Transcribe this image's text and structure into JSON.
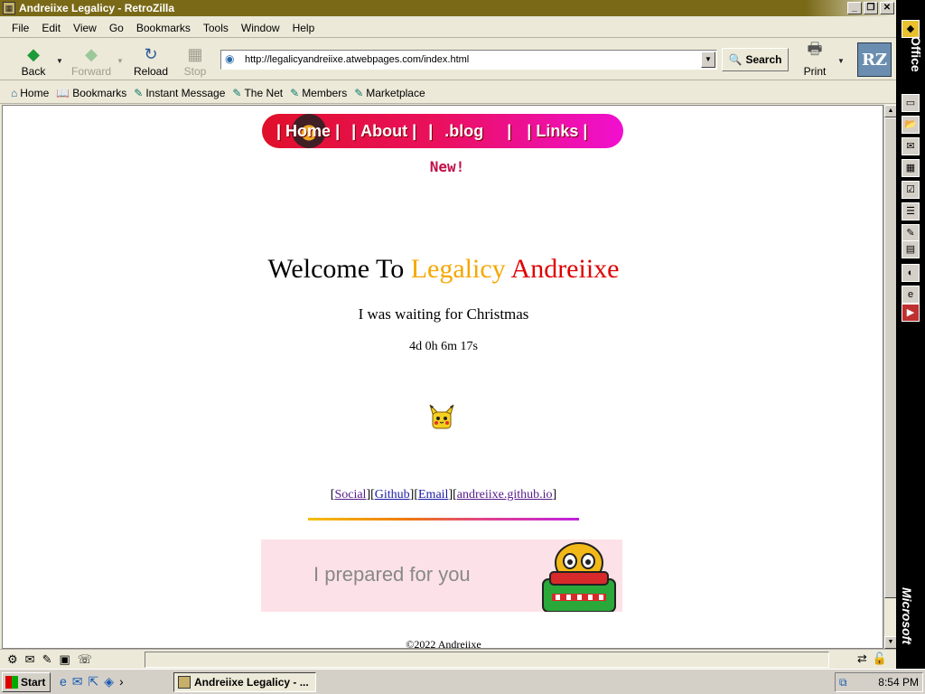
{
  "window": {
    "title": "Andreiixe Legalicy - RetroZilla",
    "buttons": {
      "minimize": "_",
      "restore": "❐",
      "close": "✕"
    }
  },
  "menu": [
    "File",
    "Edit",
    "View",
    "Go",
    "Bookmarks",
    "Tools",
    "Window",
    "Help"
  ],
  "toolbar": {
    "back": "Back",
    "forward": "Forward",
    "reload": "Reload",
    "stop": "Stop",
    "url": "http://legalicyandreiixe.atwebpages.com/index.html",
    "search": "Search",
    "print": "Print",
    "logo": "RZ"
  },
  "bookmarks": [
    "Home",
    "Bookmarks",
    "Instant Message",
    "The Net",
    "Members",
    "Marketplace"
  ],
  "page": {
    "nav": {
      "home": "Home",
      "about": "About",
      "blog": ".blog",
      "links": "Links",
      "sep": "|"
    },
    "new_label": "New!",
    "welcome": {
      "part1": "Welcome To",
      "part2": "Legalicy",
      "part3": "Andreiixe"
    },
    "waiting": "I was waiting for Christmas",
    "countdown": "4d 0h 6m 17s",
    "links": [
      "Social",
      "Github",
      "Email",
      "andreiixe.github.io"
    ],
    "banner_text": "I prepared for you",
    "copyright": "©2022 Andreiixe"
  },
  "officebar": {
    "label": "Office",
    "brand": "Microsoft"
  },
  "taskbar": {
    "start": "Start",
    "task": "Andreiixe Legalicy - ...",
    "clock": "8:54 PM"
  },
  "colors": {
    "welcome_orange": "#f5a700",
    "welcome_red": "#e00000",
    "nav_gradient_start": "#e0102a",
    "nav_gradient_end": "#f010d0"
  }
}
